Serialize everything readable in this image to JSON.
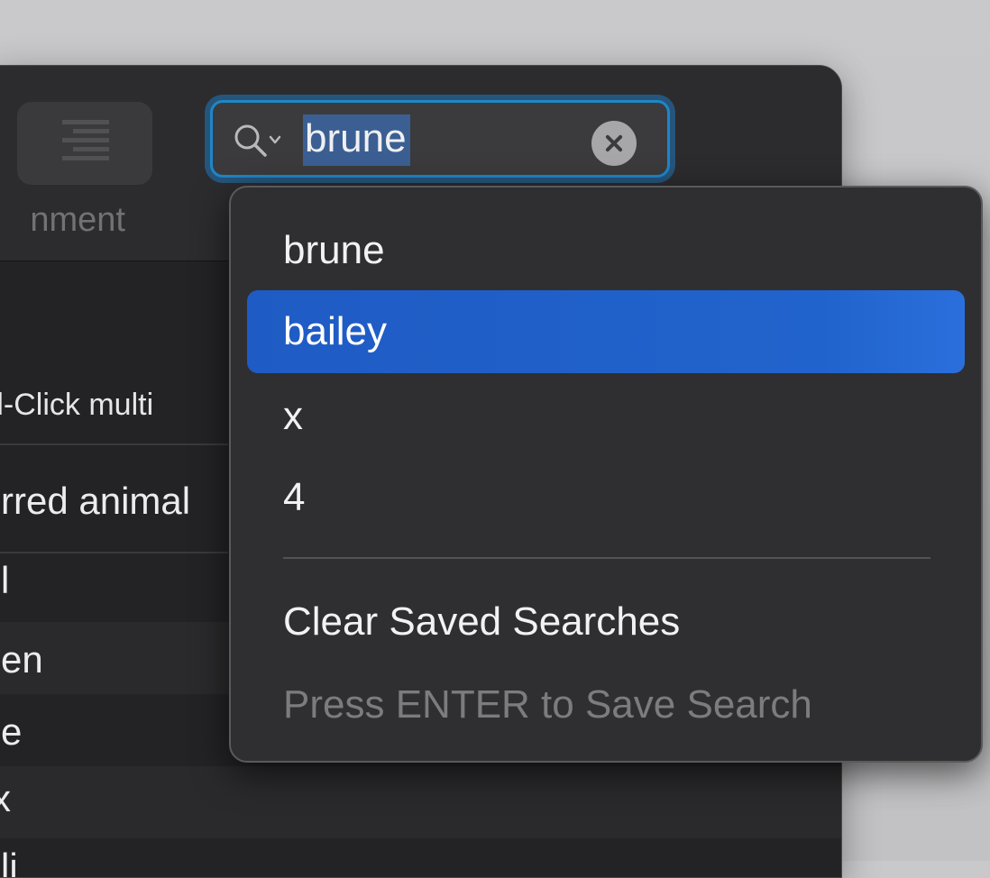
{
  "toolbar": {
    "alignment_label": "nment"
  },
  "search": {
    "value": "brune"
  },
  "sidebar": {
    "hint": "d-Click multi",
    "rows": [
      "rred animal",
      "l",
      "en",
      "e",
      "x",
      "li"
    ]
  },
  "dropdown": {
    "recent_searches": [
      "brune",
      "bailey",
      "x",
      "4"
    ],
    "highlighted": "bailey",
    "clear_label": "Clear Saved Searches",
    "save_hint": "Press ENTER to Save Search"
  },
  "colors": {
    "focus_ring": "#1f86c8",
    "highlight": "#1f5bc4",
    "selection": "#3b5f93"
  }
}
